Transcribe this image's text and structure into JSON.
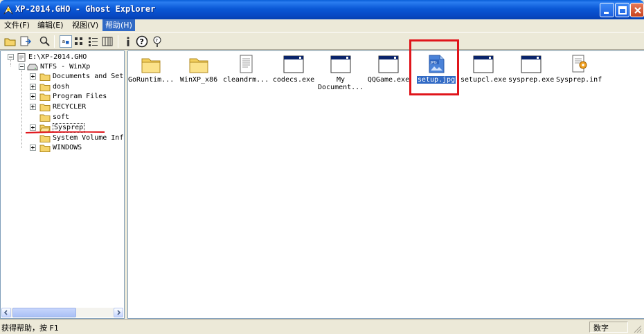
{
  "window": {
    "title": "XP-2014.GHO - Ghost Explorer"
  },
  "menu": [
    {
      "label": "文件(F)"
    },
    {
      "label": "编辑(E)"
    },
    {
      "label": "视图(V)"
    },
    {
      "label": "帮助(H)"
    }
  ],
  "tree": {
    "root": "E:\\XP-2014.GHO",
    "volume": "NTFS - WinXp",
    "folders": [
      {
        "label": "Documents and Setti",
        "expandable": true
      },
      {
        "label": "dosh",
        "expandable": true
      },
      {
        "label": "Program Files",
        "expandable": true
      },
      {
        "label": "RECYCLER",
        "expandable": true
      },
      {
        "label": "soft",
        "expandable": false
      },
      {
        "label": "Sysprep",
        "expandable": true
      },
      {
        "label": "System Volume Infor",
        "expandable": false
      },
      {
        "label": "WINDOWS",
        "expandable": true
      }
    ]
  },
  "files": [
    {
      "label": "GoRuntim...",
      "icon": "folder-icon"
    },
    {
      "label": "WinXP_x86",
      "icon": "folder-icon"
    },
    {
      "label": "cleandrm...",
      "icon": "text-file-icon"
    },
    {
      "label": "codecs.exe",
      "icon": "exe-window-icon"
    },
    {
      "label": "My Document...",
      "icon": "exe-window-icon"
    },
    {
      "label": "QQGame.exe",
      "icon": "exe-window-icon"
    },
    {
      "label": "setup.jpg",
      "icon": "jpg-image-icon",
      "selected": true
    },
    {
      "label": "setupcl.exe",
      "icon": "exe-window-icon"
    },
    {
      "label": "sysprep.exe",
      "icon": "exe-window-icon"
    },
    {
      "label": "Sysprep.inf",
      "icon": "inf-settings-icon"
    }
  ],
  "status": {
    "text": "获得帮助，按 F1",
    "num": "数字"
  },
  "colors": {
    "selection": "#316ac5",
    "annotation_red": "#e0151b",
    "title_blue": "#0a58d6"
  }
}
